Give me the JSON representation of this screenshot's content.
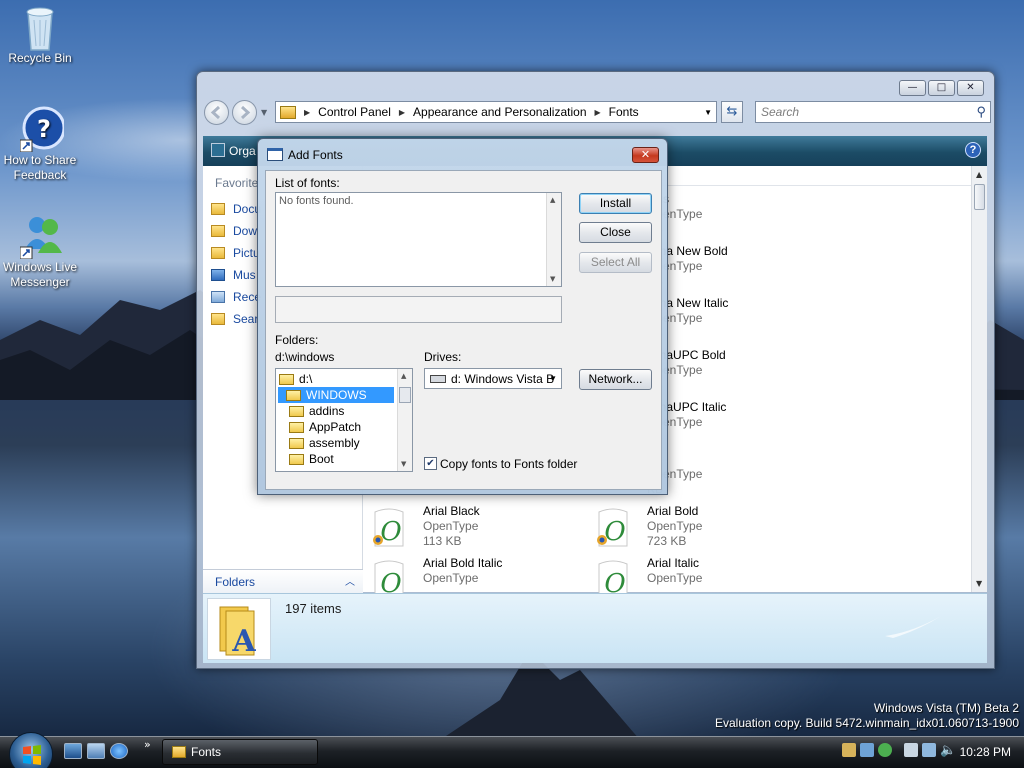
{
  "desktop": {
    "icons": [
      {
        "label": "Recycle Bin"
      },
      {
        "label": "How to Share Feedback"
      },
      {
        "label": "Windows Live Messenger"
      }
    ],
    "watermark": {
      "line1": "Windows Vista (TM) Beta 2",
      "line2": "Evaluation copy. Build 5472.winmain_idx01.060713-1900"
    }
  },
  "explorer": {
    "caption_buttons": {
      "minimize": "—",
      "maximize": "□",
      "close": "✕"
    },
    "address": {
      "crumbs": [
        "Control Panel",
        "Appearance and Personalization",
        "Fonts"
      ]
    },
    "search": {
      "placeholder": "Search"
    },
    "toolbar": {
      "organize": "Orga",
      "help": "?"
    },
    "nav_pane": {
      "favorites_header": "Favorite",
      "items": [
        "Docu",
        "Dow",
        "Pictu",
        "Mus",
        "Rece",
        "Sear"
      ],
      "folders_label": "Folders"
    },
    "fonts": [
      {
        "name": "alus",
        "type": "OpenType",
        "size": "KB"
      },
      {
        "name": "sana New Bold",
        "type": "OpenType",
        "size": "KB"
      },
      {
        "name": "sana New Italic",
        "type": "OpenType",
        "size": "KB"
      },
      {
        "name": "sanaUPC Bold",
        "type": "OpenType",
        "size": "KB"
      },
      {
        "name": "sanaUPC Italic",
        "type": "OpenType",
        "size": "KB"
      },
      {
        "name": "",
        "type": "OpenType",
        "size": "KB"
      },
      {
        "name": "Arial Black",
        "type": "OpenType",
        "size": "113 KB"
      },
      {
        "name": "Arial Bold",
        "type": "OpenType",
        "size": "723 KB"
      },
      {
        "name": "Arial Bold Italic",
        "type": "OpenType",
        "size": ""
      },
      {
        "name": "Arial Italic",
        "type": "OpenType",
        "size": ""
      }
    ],
    "details": {
      "item_count": "197 items"
    }
  },
  "dialog": {
    "title": "Add Fonts",
    "list_label": "List of fonts:",
    "list_empty": "No fonts found.",
    "folders_label": "Folders:",
    "current_path": "d:\\windows",
    "drives_label": "Drives:",
    "drive_value": "d: Windows Vista B",
    "folders": [
      "d:\\",
      "WINDOWS",
      "addins",
      "AppPatch",
      "assembly",
      "Boot"
    ],
    "buttons": {
      "install": "Install",
      "close": "Close",
      "select_all": "Select All",
      "network": "Network..."
    },
    "copy_checkbox": {
      "label": "Copy fonts to Fonts folder",
      "checked": true
    }
  },
  "taskbar": {
    "task_label": "Fonts",
    "clock": "10:28 PM"
  }
}
